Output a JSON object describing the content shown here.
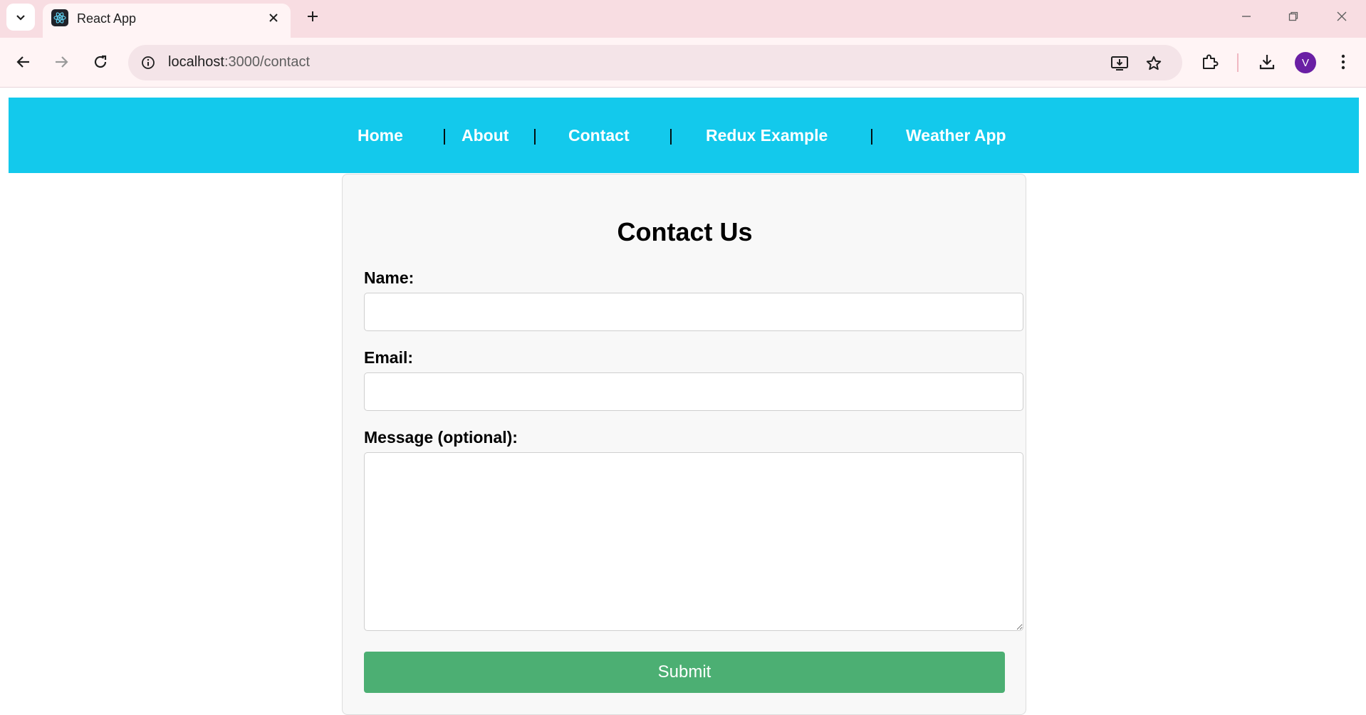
{
  "browser": {
    "tab_title": "React App",
    "url_host": "localhost",
    "url_path": ":3000/contact",
    "profile_initial": "V",
    "icons": [
      "tab-search-icon",
      "react-logo-icon",
      "close-icon",
      "plus-icon",
      "minimize-icon",
      "restore-icon",
      "window-close-icon",
      "back-icon",
      "forward-icon",
      "reload-icon",
      "site-info-icon",
      "install-app-icon",
      "bookmark-star-icon",
      "extensions-icon",
      "download-icon",
      "menu-kebab-icon"
    ]
  },
  "nav": {
    "links": [
      "Home",
      "About",
      "Contact",
      "Redux Example",
      "Weather App"
    ],
    "separator": "|",
    "background": "#13c9ec"
  },
  "form": {
    "title": "Contact Us",
    "name_label": "Name:",
    "name_value": "",
    "email_label": "Email:",
    "email_value": "",
    "message_label": "Message (optional):",
    "message_value": "",
    "submit_label": "Submit",
    "submit_color": "#4caf73"
  }
}
